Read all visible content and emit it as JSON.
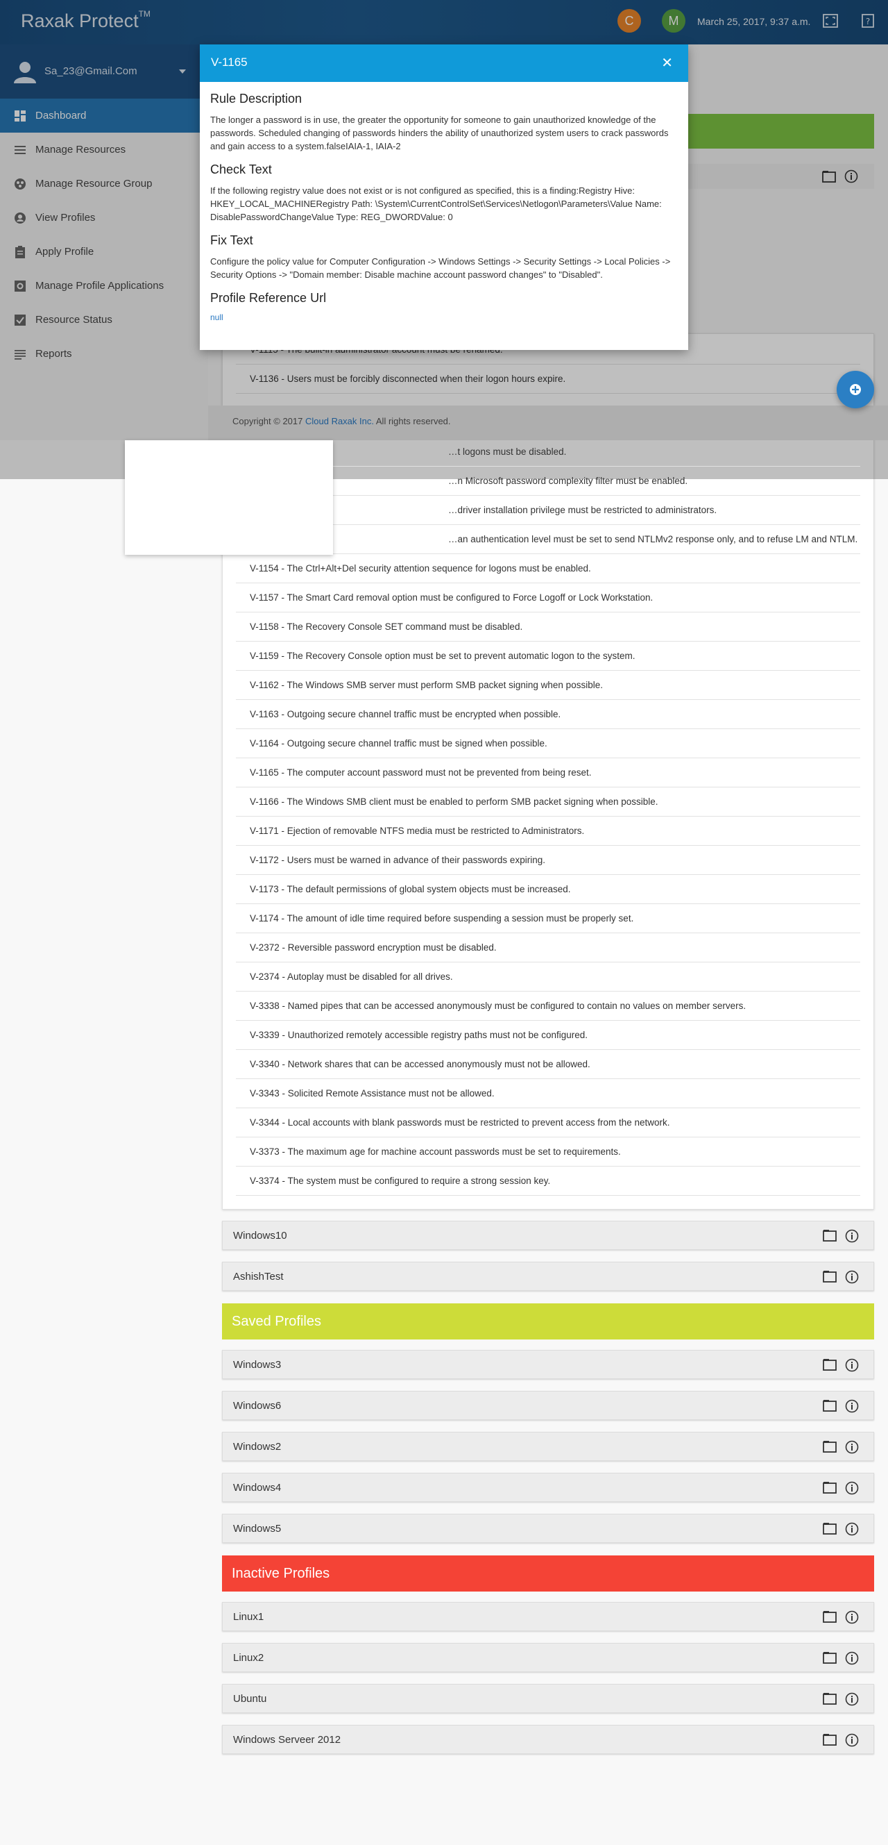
{
  "app": {
    "brand": "Raxak Protect",
    "trademark": "TM",
    "date": "March 25, 2017, 9:37 a.m."
  },
  "top_avatars": [
    {
      "letter": "C",
      "color": "#e8842a"
    },
    {
      "letter": "M",
      "color": "#58a043"
    }
  ],
  "user": {
    "email": "Sa_23@Gmail.Com"
  },
  "sidebar": {
    "items": [
      {
        "label": "Dashboard",
        "icon": "dashboard-icon",
        "active": true
      },
      {
        "label": "Manage Resources",
        "icon": "list-icon"
      },
      {
        "label": "Manage Resource Group",
        "icon": "group-icon"
      },
      {
        "label": "View Profiles",
        "icon": "profile-icon"
      },
      {
        "label": "Apply Profile",
        "icon": "clipboard-icon"
      },
      {
        "label": "Manage Profile Applications",
        "icon": "settings-box-icon"
      },
      {
        "label": "Resource Status",
        "icon": "check-box-icon"
      },
      {
        "label": "Reports",
        "icon": "reports-icon"
      }
    ]
  },
  "footer": {
    "prefix": "Copyright © 2017 ",
    "link": "Cloud Raxak Inc.",
    "suffix": " All rights reserved."
  },
  "modal": {
    "title": "V-1165",
    "sections": [
      {
        "heading": "Rule Description",
        "text": "The longer a password is in use, the greater the opportunity for someone to gain unauthorized knowledge of the passwords. Scheduled changing of passwords hinders the ability of unauthorized system users to crack passwords and gain access to a system.falseIAIA-1, IAIA-2"
      },
      {
        "heading": "Check Text",
        "text": "If the following registry value does not exist or is not configured as specified, this is a finding:Registry Hive: HKEY_LOCAL_MACHINERegistry Path: \\System\\CurrentControlSet\\Services\\Netlogon\\Parameters\\Value Name: DisablePasswordChangeValue Type: REG_DWORDValue: 0"
      },
      {
        "heading": "Fix Text",
        "text": "Configure the policy value for Computer Configuration -> Windows Settings -> Security Settings -> Local Policies -> Security Options -> \"Domain member: Disable machine account password changes\" to \"Disabled\"."
      },
      {
        "heading": "Profile Reference Url",
        "text": "null"
      }
    ]
  },
  "rules_under_modal": [
    "V-1115 - The built-in administrator account must be renamed.",
    "V-1136 - Users must be forcibly disconnected when their logon hours expire."
  ],
  "rules": [
    "V-1145 - Automatic logons must be disabled.",
    "V-1151 - The print driver installation privilege must be restricted to administrators.",
    "V-1153 - The LanMan authentication level must be set to send NTLMv2 response only, and to refuse LM and NTLM.",
    "V-1154 - The Ctrl+Alt+Del security attention sequence for logons must be enabled.",
    "V-1157 - The Smart Card removal option must be configured to Force Logoff or Lock Workstation.",
    "V-1158 - The Recovery Console SET command must be disabled.",
    "V-1159 - The Recovery Console option must be set to prevent automatic logon to the system.",
    "V-1162 - The Windows SMB server must perform SMB packet signing when possible.",
    "V-1163 - Outgoing secure channel traffic must be encrypted when possible.",
    "V-1164 - Outgoing secure channel traffic must be signed when possible.",
    "V-1165 - The computer account password must not be prevented from being reset.",
    "V-1166 - The Windows SMB client must be enabled to perform SMB packet signing when possible.",
    "V-1171 - Ejection of removable NTFS media must be restricted to Administrators.",
    "V-1172 - Users must be warned in advance of their passwords expiring.",
    "V-1173 - The default permissions of global system objects must be increased.",
    "V-1174 - The amount of idle time required before suspending a session must be properly set.",
    "V-2372 - Reversible password encryption must be disabled.",
    "V-2374 - Autoplay must be disabled for all drives.",
    "V-3338 - Named pipes that can be accessed anonymously must be configured to contain no values on member servers.",
    "V-3339 - Unauthorized remotely accessible registry paths must not be configured.",
    "V-3340 - Network shares that can be accessed anonymously must not be allowed.",
    "V-3343 - Solicited Remote Assistance must not be allowed.",
    "V-3344 - Local accounts with blank passwords must be restricted to prevent access from the network.",
    "V-3373 - The maximum age for machine account passwords must be set to requirements.",
    "V-3374 - The system must be configured to require a strong session key."
  ],
  "rules_partially_hidden": [
    "…t logons must be disabled.",
    "…n Microsoft password complexity filter must be enabled.",
    "…driver installation privilege must be restricted to administrators.",
    "…an authentication level must be set to send NTLMv2 response only, and to refuse LM and NTLM."
  ],
  "active_profiles_extra": [
    "Windows10",
    "AshishTest"
  ],
  "saved_profiles": {
    "title": "Saved Profiles",
    "color": "#cddc39",
    "items": [
      "Windows3",
      "Windows6",
      "Windows2",
      "Windows4",
      "Windows5"
    ]
  },
  "inactive_profiles": {
    "title": "Inactive Profiles",
    "color": "#f44336",
    "items": [
      "Linux1",
      "Linux2",
      "Ubuntu",
      "Windows Serveer 2012"
    ]
  }
}
